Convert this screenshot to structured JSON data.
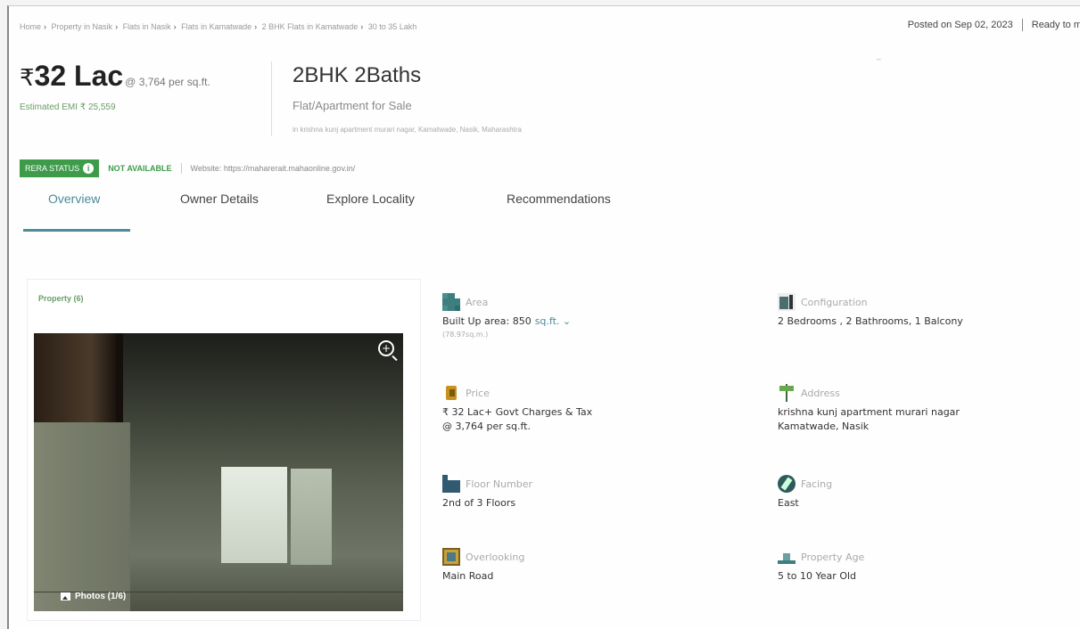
{
  "breadcrumb": {
    "items": [
      "Home",
      "Property in Nasik",
      "Flats in Nasik",
      "Flats in Kamatwade",
      "2 BHK Flats in Kamatwade",
      "30 to 35 Lakh"
    ]
  },
  "header": {
    "posted_on": "Posted on Sep 02, 2023",
    "ready_to": "Ready to m"
  },
  "price": {
    "currency": "₹",
    "amount": "32 Lac",
    "per_sqft": "@ 3,764 per sq.ft.",
    "emi": "Estimated EMI ₹ 25,559"
  },
  "property": {
    "title": "2BHK 2Baths",
    "subtitle": "Flat/Apartment for Sale",
    "address_line": "in krishna kunj apartment murari nagar, Kamatwade, Nasik, Maharashtra"
  },
  "rera": {
    "label": "RERA STATUS",
    "status": "NOT AVAILABLE",
    "website": "Website: https://maharerait.mahaonline.gov.in/"
  },
  "tabs": [
    {
      "label": "Overview"
    },
    {
      "label": "Owner Details"
    },
    {
      "label": "Explore Locality"
    },
    {
      "label": "Recommendations"
    }
  ],
  "gallery": {
    "label": "Property (6)",
    "photos_count": "Photos (1/6)"
  },
  "details": {
    "area": {
      "label": "Area",
      "value": "Built Up area: 850",
      "unit": "sq.ft.",
      "sub": "(78.97sq.m.)"
    },
    "configuration": {
      "label": "Configuration",
      "value": "2 Bedrooms , 2 Bathrooms, 1 Balcony"
    },
    "price": {
      "label": "Price",
      "value": "₹ 32 Lac+ Govt Charges & Tax",
      "sub_value": "@ 3,764 per sq.ft."
    },
    "address": {
      "label": "Address",
      "value": "krishna kunj apartment murari nagar",
      "sub_value": "Kamatwade, Nasik"
    },
    "floor": {
      "label": "Floor Number",
      "value": "2nd of 3 Floors"
    },
    "facing": {
      "label": "Facing",
      "value": "East"
    },
    "overlooking": {
      "label": "Overlooking",
      "value": "Main Road"
    },
    "age": {
      "label": "Property Age",
      "value": "5 to 10 Year Old"
    }
  },
  "colors": {
    "accent": "#4d8a9a",
    "rera_green": "#3d9b4a"
  },
  "icons": {
    "area": "area-icon",
    "configuration": "configuration-icon",
    "price": "price-icon",
    "address": "address-icon",
    "floor": "floor-icon",
    "facing": "compass-icon",
    "overlooking": "window-icon",
    "age": "building-age-icon",
    "zoom": "zoom-in-icon",
    "photos": "photo-icon",
    "info": "info-icon",
    "chevron": "chevron-down-icon"
  }
}
